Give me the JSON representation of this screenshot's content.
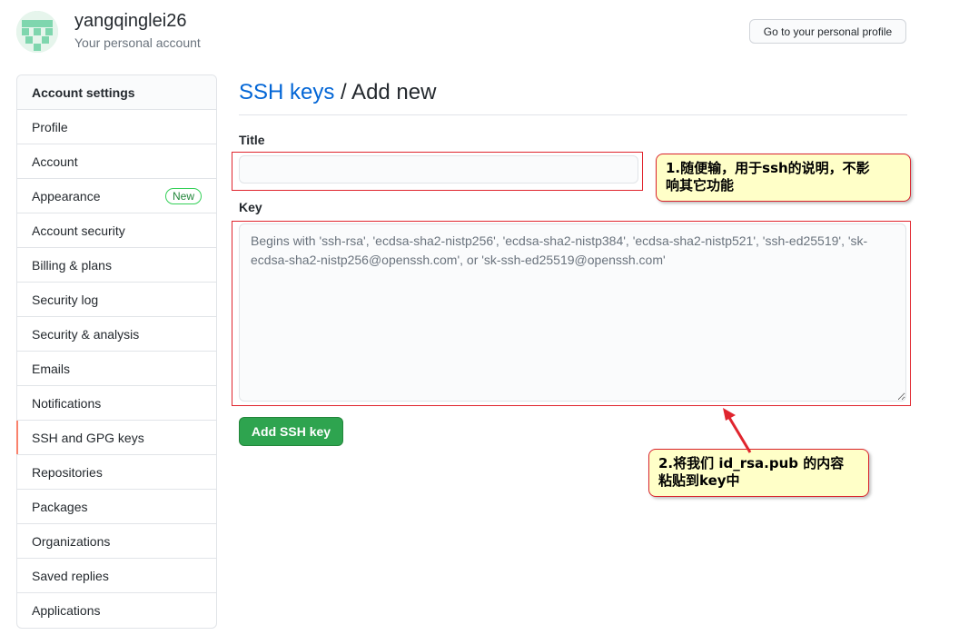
{
  "user": {
    "name": "yangqinglei26",
    "subtitle": "Your personal account",
    "profile_button": "Go to your personal profile",
    "avatar_color": "#7fd6ae"
  },
  "sidebar": {
    "heading": "Account settings",
    "items": [
      {
        "label": "Profile"
      },
      {
        "label": "Account"
      },
      {
        "label": "Appearance",
        "badge": "New"
      },
      {
        "label": "Account security"
      },
      {
        "label": "Billing & plans"
      },
      {
        "label": "Security log"
      },
      {
        "label": "Security & analysis"
      },
      {
        "label": "Emails"
      },
      {
        "label": "Notifications"
      },
      {
        "label": "SSH and GPG keys",
        "active": true
      },
      {
        "label": "Repositories"
      },
      {
        "label": "Packages"
      },
      {
        "label": "Organizations"
      },
      {
        "label": "Saved replies"
      },
      {
        "label": "Applications"
      }
    ]
  },
  "main": {
    "title_link": "SSH keys",
    "title_rest": " / Add new",
    "title_label": "Title",
    "title_value": "",
    "key_label": "Key",
    "key_placeholder": "Begins with 'ssh-rsa', 'ecdsa-sha2-nistp256', 'ecdsa-sha2-nistp384', 'ecdsa-sha2-nistp521', 'ssh-ed25519', 'sk-ecdsa-sha2-nistp256@openssh.com', or 'sk-ssh-ed25519@openssh.com'",
    "submit_label": "Add SSH key"
  },
  "annotations": {
    "note1_line1": "1.随便输，用于ssh的说明，不影",
    "note1_line2": "响其它功能",
    "note2_line1": "2.将我们 id_rsa.pub 的内容",
    "note2_line2": "粘贴到key中",
    "highlight_color": "#e0252e"
  },
  "colors": {
    "link": "#0366d6",
    "primary_button": "#2ea44f",
    "active_marker": "#f9826c"
  }
}
